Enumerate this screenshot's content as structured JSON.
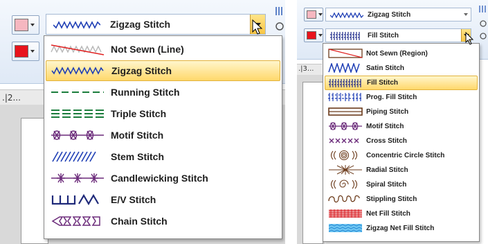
{
  "left_panel": {
    "combo_value": "Zigzag Stitch",
    "ruler_label": ".|2...",
    "menu_items": [
      {
        "label": "Not Sewn (Line)",
        "icon": "not-sewn-line-icon",
        "selected": false
      },
      {
        "label": "Zigzag Stitch",
        "icon": "zigzag-stitch-icon",
        "selected": true
      },
      {
        "label": "Running Stitch",
        "icon": "running-stitch-icon",
        "selected": false
      },
      {
        "label": "Triple Stitch",
        "icon": "triple-stitch-icon",
        "selected": false
      },
      {
        "label": "Motif Stitch",
        "icon": "motif-stitch-icon",
        "selected": false
      },
      {
        "label": "Stem Stitch",
        "icon": "stem-stitch-icon",
        "selected": false
      },
      {
        "label": "Candlewicking Stitch",
        "icon": "candlewicking-stitch-icon",
        "selected": false
      },
      {
        "label": "E/V Stitch",
        "icon": "ev-stitch-icon",
        "selected": false
      },
      {
        "label": "Chain Stitch",
        "icon": "chain-stitch-icon",
        "selected": false
      }
    ]
  },
  "right_panel": {
    "line_combo_value": "Zigzag Stitch",
    "fill_combo_value": "Fill Stitch",
    "ruler_label": ".|3...",
    "menu_items": [
      {
        "label": "Not Sewn (Region)",
        "icon": "not-sewn-region-icon",
        "selected": false
      },
      {
        "label": "Satin Stitch",
        "icon": "satin-stitch-icon",
        "selected": false
      },
      {
        "label": "Fill Stitch",
        "icon": "fill-stitch-icon",
        "selected": true
      },
      {
        "label": "Prog. Fill Stitch",
        "icon": "prog-fill-stitch-icon",
        "selected": false
      },
      {
        "label": "Piping Stitch",
        "icon": "piping-stitch-icon",
        "selected": false
      },
      {
        "label": "Motif Stitch",
        "icon": "motif-stitch-icon",
        "selected": false
      },
      {
        "label": "Cross Stitch",
        "icon": "cross-stitch-icon",
        "selected": false
      },
      {
        "label": "Concentric Circle Stitch",
        "icon": "concentric-circle-stitch-icon",
        "selected": false
      },
      {
        "label": "Radial Stitch",
        "icon": "radial-stitch-icon",
        "selected": false
      },
      {
        "label": "Spiral Stitch",
        "icon": "spiral-stitch-icon",
        "selected": false
      },
      {
        "label": "Stippling Stitch",
        "icon": "stippling-stitch-icon",
        "selected": false
      },
      {
        "label": "Net Fill Stitch",
        "icon": "net-fill-stitch-icon",
        "selected": false
      },
      {
        "label": "Zigzag Net Fill Stitch",
        "icon": "zigzag-net-fill-stitch-icon",
        "selected": false
      }
    ]
  },
  "colors": {
    "line_color_swatch": "#f6b7c0",
    "region_color_swatch": "#e8141c",
    "stitch_blue": "#1f3fb5",
    "stitch_green": "#1b7d3c",
    "stitch_purple": "#6b2a7a",
    "stitch_brown": "#6b3a1a",
    "highlight": "#ffd86b"
  }
}
